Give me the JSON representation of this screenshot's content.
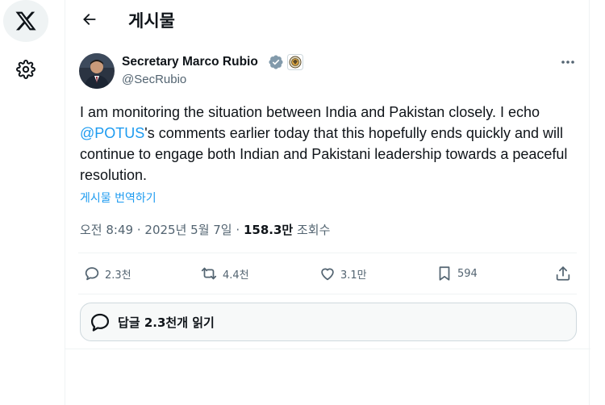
{
  "header": {
    "title": "게시물"
  },
  "post": {
    "author_name": "Secretary Marco Rubio",
    "author_handle": "@SecRubio",
    "text_before": "I am monitoring the situation between India and Pakistan closely. I echo ",
    "mention": "@POTUS",
    "text_after": "'s comments earlier today that this hopefully ends quickly and will continue to engage both Indian and Pakistani leadership towards a peaceful resolution.",
    "translate": "게시물 번역하기",
    "time": "오전 8:49",
    "separator": "·",
    "date": "2025년 5월 7일",
    "views_count": "158.3만",
    "views_label": "조회수"
  },
  "actions": {
    "replies": "2.3천",
    "reposts": "4.4천",
    "likes": "3.1만",
    "bookmarks": "594"
  },
  "read_replies": {
    "label": "답글 2.3천개 읽기"
  },
  "colors": {
    "accent": "#1d9bf0",
    "text": "#0f1419",
    "muted": "#536471"
  }
}
